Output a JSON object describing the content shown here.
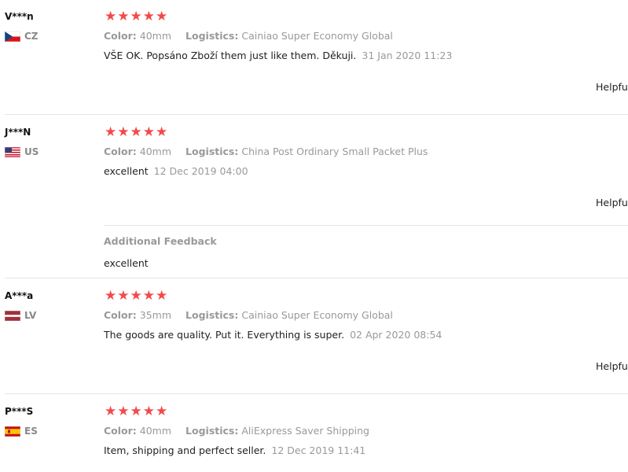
{
  "reviews": [
    {
      "user": "V***n",
      "country_code": "CZ",
      "flag_icon": "czech-flag-icon",
      "rating": 5,
      "stars": "★★★★★",
      "color_label": "Color:",
      "color_value": "40mm",
      "logistics_label": "Logistics:",
      "logistics_value": "Cainiao Super Economy Global",
      "text": "VŠE OK. Popsáno Zboží them just like them. Děkuji.",
      "date": "31 Jan 2020 11:23",
      "helpful": "Helpfu"
    },
    {
      "user": "J***N",
      "country_code": "US",
      "flag_icon": "us-flag-icon",
      "rating": 5,
      "stars": "★★★★★",
      "color_label": "Color:",
      "color_value": "40mm",
      "logistics_label": "Logistics:",
      "logistics_value": "China Post Ordinary Small Packet Plus",
      "text": "excellent",
      "date": "12 Dec 2019 04:00",
      "helpful": "Helpfu",
      "additional_feedback_title": "Additional Feedback",
      "additional_feedback_text": "excellent"
    },
    {
      "user": "A***a",
      "country_code": "LV",
      "flag_icon": "latvia-flag-icon",
      "rating": 5,
      "stars": "★★★★★",
      "color_label": "Color:",
      "color_value": "35mm",
      "logistics_label": "Logistics:",
      "logistics_value": "Cainiao Super Economy Global",
      "text": "The goods are quality. Put it. Everything is super.",
      "date": "02 Apr 2020 08:54",
      "helpful": "Helpfu"
    },
    {
      "user": "P***S",
      "country_code": "ES",
      "flag_icon": "spain-flag-icon",
      "rating": 5,
      "stars": "★★★★★",
      "color_label": "Color:",
      "color_value": "40mm",
      "logistics_label": "Logistics:",
      "logistics_value": "AliExpress Saver Shipping",
      "text": "Item, shipping and perfect seller.",
      "date": "12 Dec 2019 11:41"
    }
  ],
  "colors": {
    "star": "#f24a4a",
    "muted": "#999999",
    "divider": "#e5e5e5"
  }
}
